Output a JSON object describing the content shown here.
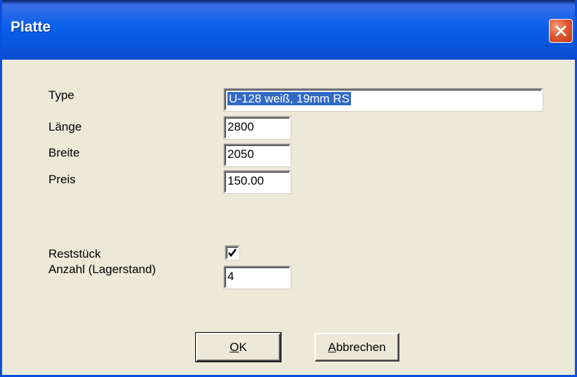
{
  "window": {
    "title": "Platte",
    "close_icon": "close-icon"
  },
  "fields": {
    "type": {
      "label": "Type",
      "value": "U-128 weiß, 19mm RS"
    },
    "laenge": {
      "label": "Länge",
      "value": "2800"
    },
    "breite": {
      "label": "Breite",
      "value": "2050"
    },
    "preis": {
      "label": "Preis",
      "value": "150.00"
    },
    "reststueck": {
      "label": "Reststück",
      "checked": true
    },
    "anzahl": {
      "label": "Anzahl (Lagerstand)",
      "value": "4"
    }
  },
  "buttons": {
    "ok": {
      "mnemonic": "O",
      "rest": "K"
    },
    "cancel": {
      "mnemonic": "A",
      "rest": "bbrechen"
    }
  },
  "colors": {
    "titlebar": "#0a5fea",
    "close": "#e0572f",
    "selection": "#316ac5",
    "face": "#ece9d8"
  }
}
